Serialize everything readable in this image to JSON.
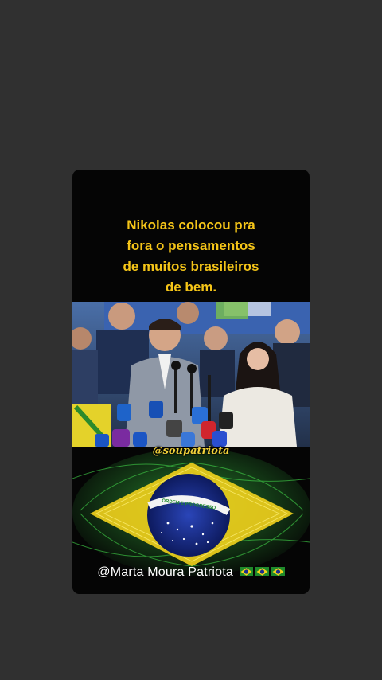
{
  "post": {
    "headline": "Nikolas colocou pra\nfora o pensamentos\nde muitos brasileiros\nde bem.",
    "watermark": "@soupatriota",
    "signature": "@Marta Moura Patriota",
    "signature_flags": [
      "brazil-flag-icon",
      "brazil-flag-icon",
      "brazil-flag-icon"
    ]
  },
  "flag_motto": "ORDEM E PROGRESSO",
  "colors": {
    "background": "#303030",
    "card": "#050505",
    "headline": "#f5c518",
    "flag_green": "#1f8a2b",
    "flag_yellow": "#f2d21c",
    "flag_blue": "#1b2f8f"
  }
}
